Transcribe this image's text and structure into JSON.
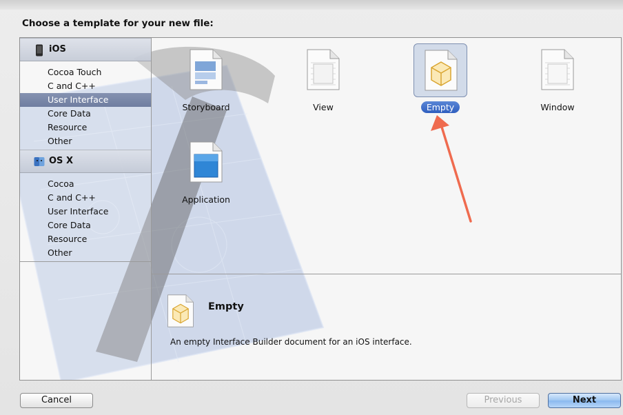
{
  "dialog": {
    "heading": "Choose a template for your new file:"
  },
  "sidebar": {
    "groups": [
      {
        "label": "iOS",
        "icon": "iphone-icon",
        "items": [
          "Cocoa Touch",
          "C and C++",
          "User Interface",
          "Core Data",
          "Resource",
          "Other"
        ],
        "selected_index": 2
      },
      {
        "label": "OS X",
        "icon": "finder-icon",
        "items": [
          "Cocoa",
          "C and C++",
          "User Interface",
          "Core Data",
          "Resource",
          "Other"
        ],
        "selected_index": null
      }
    ]
  },
  "templates": [
    {
      "label": "Storyboard",
      "icon": "storyboard-file-icon",
      "selected": false
    },
    {
      "label": "View",
      "icon": "view-file-icon",
      "selected": false
    },
    {
      "label": "Empty",
      "icon": "empty-file-icon",
      "selected": true
    },
    {
      "label": "Window",
      "icon": "window-file-icon",
      "selected": false
    },
    {
      "label": "Application",
      "icon": "application-file-icon",
      "selected": false
    }
  ],
  "detail": {
    "title": "Empty",
    "description": "An empty Interface Builder document for an iOS interface.",
    "icon": "empty-file-icon"
  },
  "buttons": {
    "cancel": "Cancel",
    "previous": "Previous",
    "next": "Next"
  },
  "colors": {
    "selection_sidebar": "#7584a5",
    "selection_tile": "#3b6bc9",
    "annotation_arrow": "#ef6b4f"
  }
}
